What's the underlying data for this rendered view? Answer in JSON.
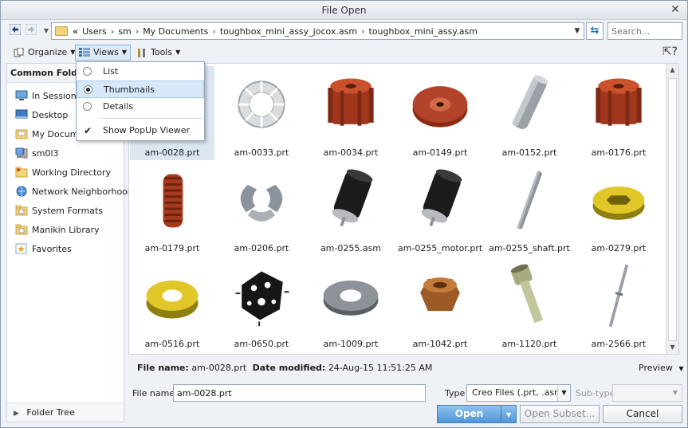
{
  "window": {
    "title": "File Open",
    "close_glyph": "✕"
  },
  "nav": {
    "back_icon": "arrow-left-icon",
    "forward_icon": "arrow-right-icon"
  },
  "address": {
    "prefix": "«",
    "segments": [
      "Users",
      "sm",
      "My Documents",
      "toughbox_mini_assy_jocox.asm",
      "toughbox_mini_assy.asm"
    ],
    "separator": "›"
  },
  "search": {
    "placeholder": "Search..."
  },
  "toolbar": {
    "organize": "Organize",
    "views": "Views",
    "tools": "Tools"
  },
  "views_menu": {
    "items": [
      {
        "label": "List",
        "selected": false
      },
      {
        "label": "Thumbnails",
        "selected": true
      },
      {
        "label": "Details",
        "selected": false
      }
    ],
    "popup_viewer": {
      "label": "Show PopUp Viewer",
      "checked": true
    }
  },
  "sidebar": {
    "header": "Common Folders",
    "items": [
      {
        "label": "In Session",
        "icon": "monitor-icon"
      },
      {
        "label": "Desktop",
        "icon": "desktop-icon"
      },
      {
        "label": "My Documents",
        "icon": "documents-icon"
      },
      {
        "label": "sm0l3",
        "icon": "computer-icon"
      },
      {
        "label": "Working Directory",
        "icon": "folder-star-icon"
      },
      {
        "label": "Network Neighborhood",
        "icon": "network-icon"
      },
      {
        "label": "System Formats",
        "icon": "folder-icon"
      },
      {
        "label": "Manikin Library",
        "icon": "folder-icon"
      },
      {
        "label": "Favorites",
        "icon": "favorites-icon"
      }
    ],
    "folder_tree": "Folder Tree"
  },
  "files": [
    {
      "name": "am-0028.prt",
      "shape": "blank",
      "selected": true
    },
    {
      "name": "am-0033.prt",
      "shape": "lockwasher"
    },
    {
      "name": "am-0034.prt",
      "shape": "gear-tall"
    },
    {
      "name": "am-0149.prt",
      "shape": "gear-flat"
    },
    {
      "name": "am-0152.prt",
      "shape": "shaft-gray"
    },
    {
      "name": "am-0176.prt",
      "shape": "gear-tall"
    },
    {
      "name": "am-0179.prt",
      "shape": "gear-side"
    },
    {
      "name": "am-0206.prt",
      "shape": "clip"
    },
    {
      "name": "am-0255.asm",
      "shape": "motor"
    },
    {
      "name": "am-0255_motor.prt",
      "shape": "motor"
    },
    {
      "name": "am-0255_shaft.prt",
      "shape": "pin"
    },
    {
      "name": "am-0279.prt",
      "shape": "yellow-hex"
    },
    {
      "name": "am-0516.prt",
      "shape": "yellow-ring"
    },
    {
      "name": "am-0650.prt",
      "shape": "black-part"
    },
    {
      "name": "am-1009.prt",
      "shape": "washer"
    },
    {
      "name": "am-1042.prt",
      "shape": "nut"
    },
    {
      "name": "am-1120.prt",
      "shape": "bolt"
    },
    {
      "name": "am-2566.prt",
      "shape": "thin-pin"
    }
  ],
  "details": {
    "file_name_label": "File name:",
    "file_name_value": "am-0028.prt",
    "date_label": "Date modified:",
    "date_value": "24-Aug-15 11:51:25 AM",
    "preview": "Preview"
  },
  "form": {
    "file_name_label": "File name:",
    "file_name_value": "am-0028.prt",
    "type_label": "Type",
    "type_value": "Creo Files (.prt, .asm,",
    "subtype_label": "Sub-type"
  },
  "buttons": {
    "open": "Open",
    "open_subset": "Open Subset...",
    "cancel": "Cancel"
  },
  "colors": {
    "accent": "#4f95d8",
    "selection": "#dbe6f1",
    "menu_highlight": "#d7e8f8"
  }
}
